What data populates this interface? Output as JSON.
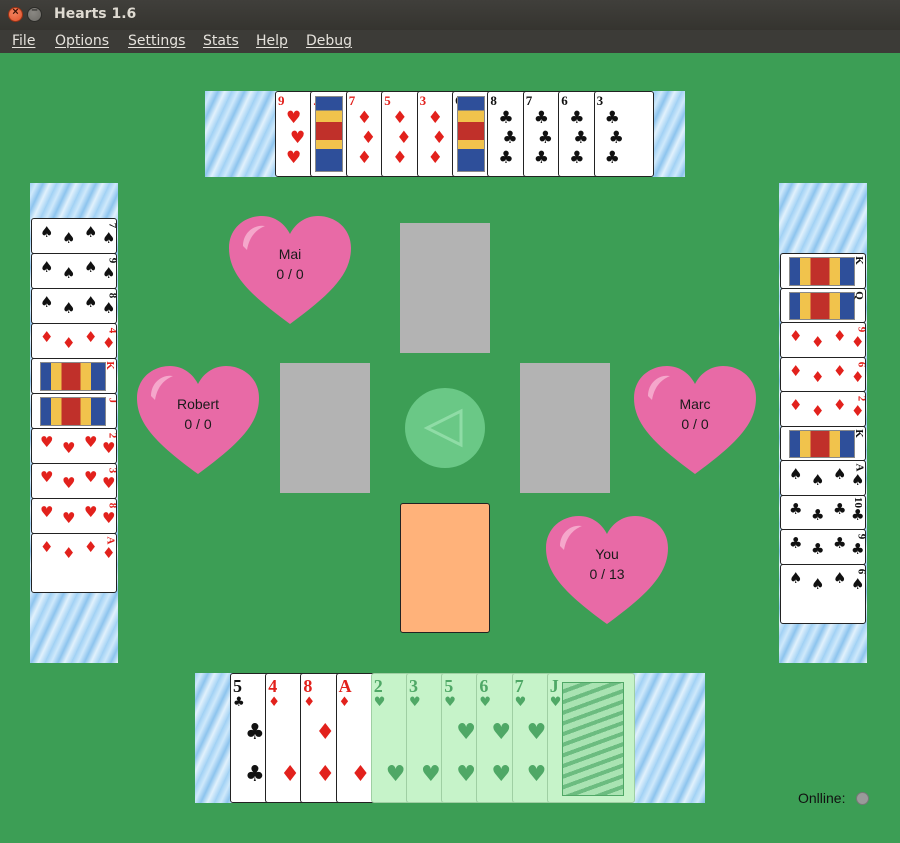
{
  "window": {
    "title": "Hearts 1.6"
  },
  "menu": [
    "File",
    "Options",
    "Settings",
    "Stats",
    "Help",
    "Debug"
  ],
  "players": [
    {
      "name": "Mai",
      "score": "0 / 0"
    },
    {
      "name": "Robert",
      "score": "0 / 0"
    },
    {
      "name": "Marc",
      "score": "0 / 0"
    },
    {
      "name": "You",
      "score": "0 / 13"
    }
  ],
  "top_hand": [
    {
      "rank": "9",
      "suit": "♥",
      "color": "red"
    },
    {
      "rank": "J",
      "suit": "♦",
      "color": "red"
    },
    {
      "rank": "7",
      "suit": "♦",
      "color": "red"
    },
    {
      "rank": "5",
      "suit": "♦",
      "color": "red"
    },
    {
      "rank": "3",
      "suit": "♦",
      "color": "red"
    },
    {
      "rank": "Q",
      "suit": "♣",
      "color": "blk"
    },
    {
      "rank": "8",
      "suit": "♣",
      "color": "blk"
    },
    {
      "rank": "7",
      "suit": "♣",
      "color": "blk"
    },
    {
      "rank": "6",
      "suit": "♣",
      "color": "blk"
    },
    {
      "rank": "3",
      "suit": "♣",
      "color": "blk"
    }
  ],
  "left_hand": [
    {
      "rank": "7",
      "suit": "♠",
      "color": "blk"
    },
    {
      "rank": "9",
      "suit": "♠",
      "color": "blk"
    },
    {
      "rank": "8",
      "suit": "♠",
      "color": "blk"
    },
    {
      "rank": "4",
      "suit": "♦",
      "color": "red"
    },
    {
      "rank": "K",
      "suit": "♦",
      "color": "red"
    },
    {
      "rank": "J",
      "suit": "♥",
      "color": "red"
    },
    {
      "rank": "2",
      "suit": "♥",
      "color": "red"
    },
    {
      "rank": "3",
      "suit": "♥",
      "color": "red"
    },
    {
      "rank": "8",
      "suit": "♥",
      "color": "red"
    },
    {
      "rank": "A",
      "suit": "♦",
      "color": "red"
    }
  ],
  "right_hand": [
    {
      "rank": "K",
      "suit": "♠",
      "color": "blk"
    },
    {
      "rank": "Q",
      "suit": "♠",
      "color": "blk"
    },
    {
      "rank": "9",
      "suit": "♦",
      "color": "red"
    },
    {
      "rank": "6",
      "suit": "♦",
      "color": "red"
    },
    {
      "rank": "2",
      "suit": "♦",
      "color": "red"
    },
    {
      "rank": "K",
      "suit": "♣",
      "color": "blk"
    },
    {
      "rank": "A",
      "suit": "♠",
      "color": "blk"
    },
    {
      "rank": "10",
      "suit": "♣",
      "color": "blk"
    },
    {
      "rank": "9",
      "suit": "♣",
      "color": "blk"
    },
    {
      "rank": "6",
      "suit": "♠",
      "color": "blk"
    }
  ],
  "my_hand": [
    {
      "rank": "5",
      "suit": "♣",
      "color": "blk",
      "playable": true
    },
    {
      "rank": "4",
      "suit": "♦",
      "color": "red",
      "playable": true
    },
    {
      "rank": "8",
      "suit": "♦",
      "color": "red",
      "playable": true
    },
    {
      "rank": "A",
      "suit": "♦",
      "color": "red",
      "playable": true
    },
    {
      "rank": "2",
      "suit": "♥",
      "color": "red",
      "playable": false
    },
    {
      "rank": "3",
      "suit": "♥",
      "color": "red",
      "playable": false
    },
    {
      "rank": "5",
      "suit": "♥",
      "color": "red",
      "playable": false
    },
    {
      "rank": "6",
      "suit": "♥",
      "color": "red",
      "playable": false
    },
    {
      "rank": "7",
      "suit": "♥",
      "color": "red",
      "playable": false
    },
    {
      "rank": "J",
      "suit": "♥",
      "color": "red",
      "playable": false
    }
  ],
  "pass_button": {
    "icon": "triangle-left-icon"
  },
  "status": {
    "online_label": "Onlline:"
  },
  "colors": {
    "table": "#3c9e55",
    "heart": "#e86aa6",
    "slot": "#b3b3b3",
    "your_slot": "#ffb27a"
  }
}
